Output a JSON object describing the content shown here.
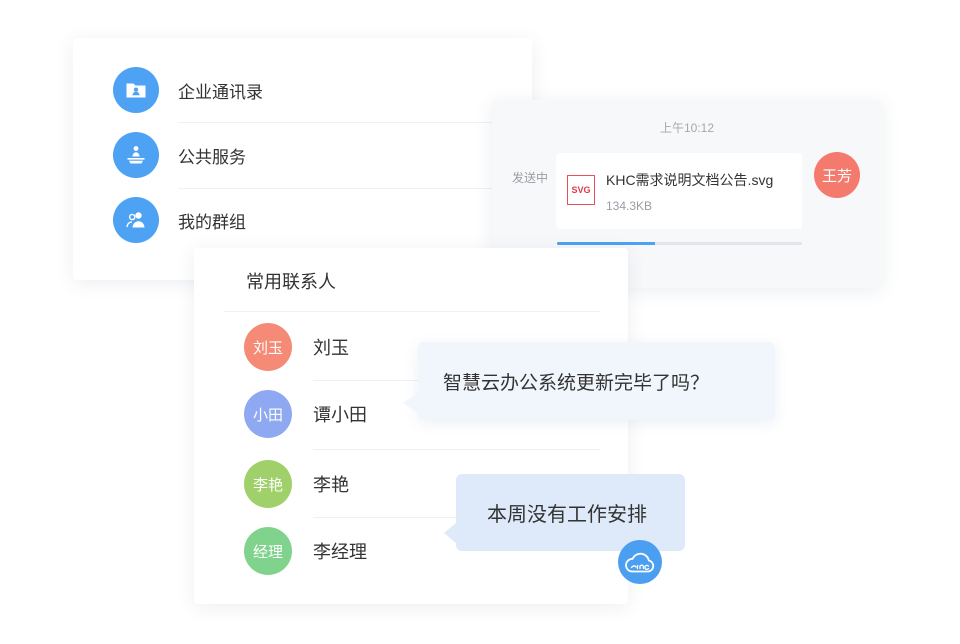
{
  "directory_menu": {
    "items": [
      {
        "label": "企业通讯录",
        "icon": "contacts-folder-icon"
      },
      {
        "label": "公共服务",
        "icon": "public-service-icon"
      },
      {
        "label": "我的群组",
        "icon": "group-icon"
      }
    ]
  },
  "file_message": {
    "time": "上午10:12",
    "status": "发送中",
    "file_type_label": "SVG",
    "file_name": "KHC需求说明文档公告.svg",
    "file_size": "134.3KB",
    "progress": 0.4,
    "sender_avatar": "王芳",
    "sender_color": "#f47a6e"
  },
  "contacts": {
    "title": "常用联系人",
    "items": [
      {
        "avatar": "刘玉",
        "name": "刘玉",
        "color": "#f58b76"
      },
      {
        "avatar": "小田",
        "name": "谭小田",
        "color": "#8ea9f1"
      },
      {
        "avatar": "李艳",
        "name": "李艳",
        "color": "#9fd06a"
      },
      {
        "avatar": "经理",
        "name": "李经理",
        "color": "#7fd38c"
      }
    ]
  },
  "bubbles": [
    {
      "text": "智慧云办公系统更新完毕了吗？"
    },
    {
      "text": "本周没有工作安排"
    }
  ],
  "colors": {
    "accent": "#4da2f3",
    "bubble_light": "#f1f6fd",
    "bubble_blue": "#deeafa"
  },
  "logo": {
    "icon": "cloud-logo-icon"
  }
}
